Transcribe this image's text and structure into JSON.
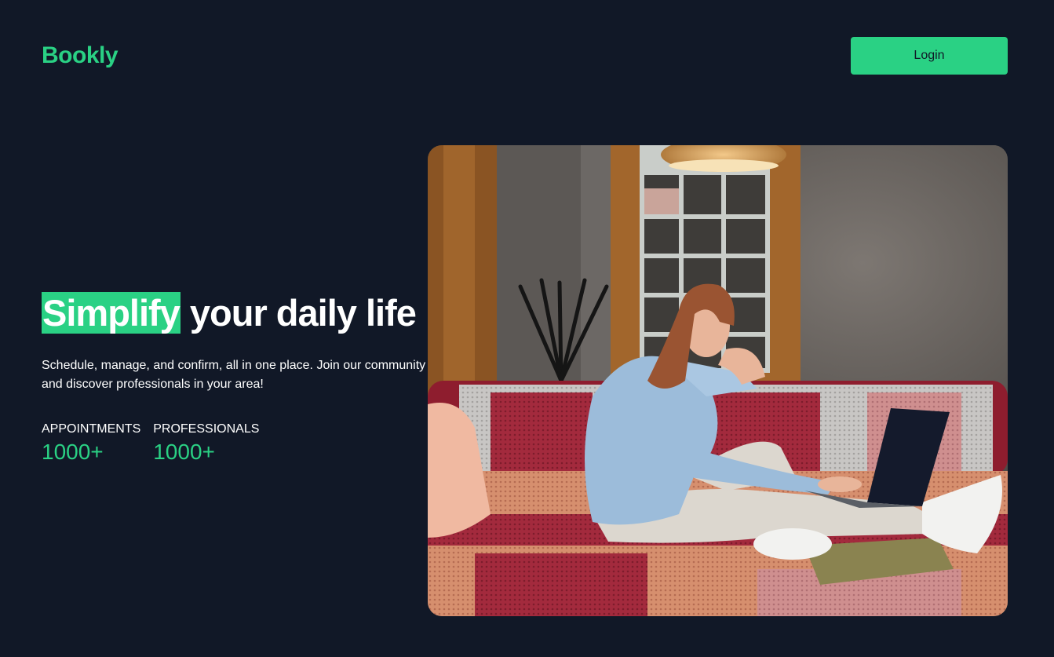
{
  "header": {
    "logo": "Bookly",
    "login_label": "Login"
  },
  "hero": {
    "headline_highlight": "Simplify",
    "headline_rest": " your daily life",
    "subtitle": "Schedule, manage, and confirm, all in one place. Join our community and discover professionals in your area!",
    "stats": [
      {
        "label": "APPOINTMENTS",
        "value": "1000+"
      },
      {
        "label": "PROFESSIONALS",
        "value": "1000+"
      }
    ],
    "image_subject": "woman-on-sofa-with-laptop-photo"
  },
  "colors": {
    "background": "#111827",
    "accent": "#2ad184",
    "text": "#ffffff"
  }
}
